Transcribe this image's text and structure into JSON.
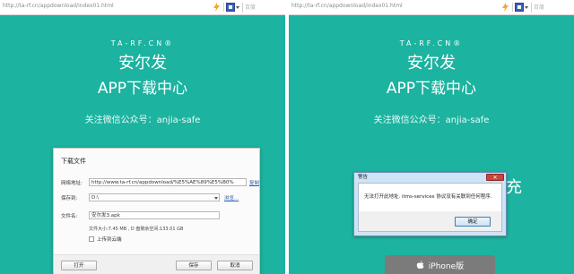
{
  "left": {
    "url": "http://ta-rf.cn/appdownload/index01.html",
    "search_placeholder": "百度",
    "brand": "TA-RF.CN®",
    "title1": "安尔发",
    "title2": "APP下载中心",
    "follow": "关注微信公众号：anjia-safe",
    "dialog": {
      "title": "下载文件",
      "url_label": "网络地址:",
      "url_value": "http://www.ta-rf.cn/appdownload/%E5%AE%89%E5%B0%",
      "copy_link": "复制",
      "save_to_label": "保存到:",
      "save_to_value": "D:\\",
      "browse_link": "浏览...",
      "filename_label": "文件名:",
      "filename_value": "安尔发3.apk",
      "file_info": "文件大小:7.45 MB , D 盘剩余空间:133.01 GB",
      "cloud_label": "上传到云端",
      "open_button": "打开",
      "save_button": "保存",
      "cancel_button": "取消"
    }
  },
  "right": {
    "url": "http://ta-rf.cn/appdownload/index01.html",
    "search_placeholder": "百度",
    "brand": "TA-RF.CN®",
    "title1": "安尔发",
    "title2": "APP下载中心",
    "follow": "关注微信公众号：anjia-safe",
    "peek_text": "充",
    "error": {
      "title": "警告",
      "close": "✕",
      "message": "无法打开此地址. itms-services 协议没有关联到任何程序.",
      "ok_button": "确定"
    },
    "iphone_button": "iPhone版"
  },
  "colors": {
    "stage": "#1cb3a0",
    "iphone_button": "#7b7b7b",
    "bolt": "#f5a623"
  },
  "icons": [
    "lightning-icon",
    "search-engine-icon",
    "apple-icon",
    "close-icon",
    "dropdown-arrow-icon"
  ]
}
